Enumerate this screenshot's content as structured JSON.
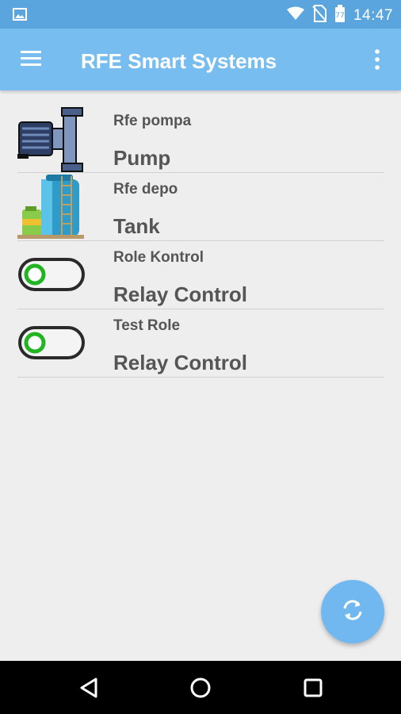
{
  "status_bar": {
    "time": "14:47",
    "icons": [
      "image-icon",
      "wifi-icon",
      "no-sim-icon",
      "battery-icon"
    ]
  },
  "app_bar": {
    "title": "RFE Smart Systems",
    "icons": [
      "menu-icon",
      "more-vert-icon"
    ]
  },
  "devices": [
    {
      "name": "Rfe pompa",
      "type": "Pump",
      "icon": "pump-icon"
    },
    {
      "name": "Rfe depo",
      "type": "Tank",
      "icon": "tank-icon"
    },
    {
      "name": "Role Kontrol",
      "type": "Relay Control",
      "icon": "toggle-switch-icon"
    },
    {
      "name": "Test Role",
      "type": "Relay Control",
      "icon": "toggle-switch-icon"
    }
  ],
  "fab": {
    "icon": "refresh-icon"
  },
  "nav_bar": {
    "icons": [
      "back-icon",
      "home-icon",
      "recents-icon"
    ]
  },
  "colors": {
    "status_bar": "#5aa5dd",
    "app_bar": "#78bdf0",
    "background": "#eeeeee",
    "text": "#555555",
    "fab": "#72b8f0",
    "toggle_green": "#22b522"
  }
}
